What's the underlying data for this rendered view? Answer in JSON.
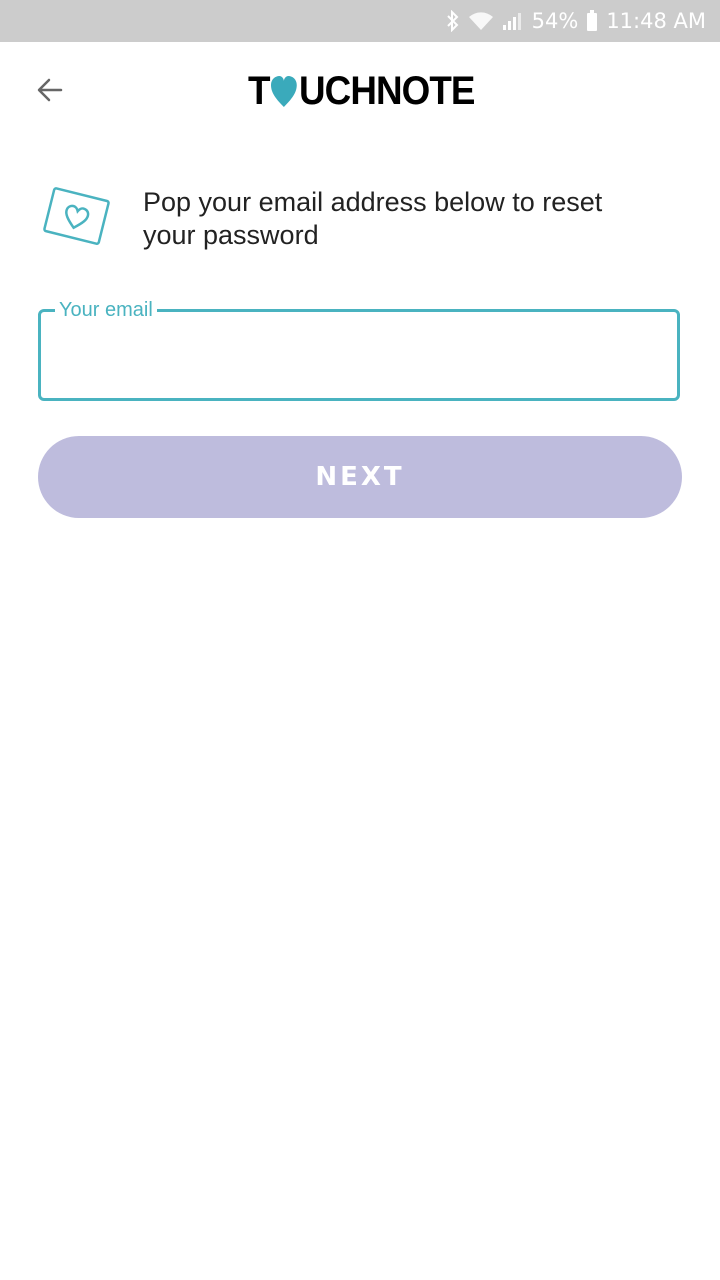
{
  "status_bar": {
    "battery": "54%",
    "time": "11:48 AM",
    "icons": [
      "bluetooth-icon",
      "wifi-icon",
      "signal-icon",
      "battery-icon"
    ]
  },
  "header": {
    "back_icon": "arrow-left-icon",
    "logo_text_before": "T",
    "logo_text_after": "UCHNOTE"
  },
  "info": {
    "icon": "postcard-heart-icon",
    "message": "Pop your email address below to reset your password"
  },
  "email": {
    "label": "Your email",
    "value": ""
  },
  "next_button": {
    "label": "NEXT"
  },
  "colors": {
    "accent": "#4ab3c0",
    "button_bg": "#bebcdd",
    "status_bar_bg": "#cccccc"
  }
}
